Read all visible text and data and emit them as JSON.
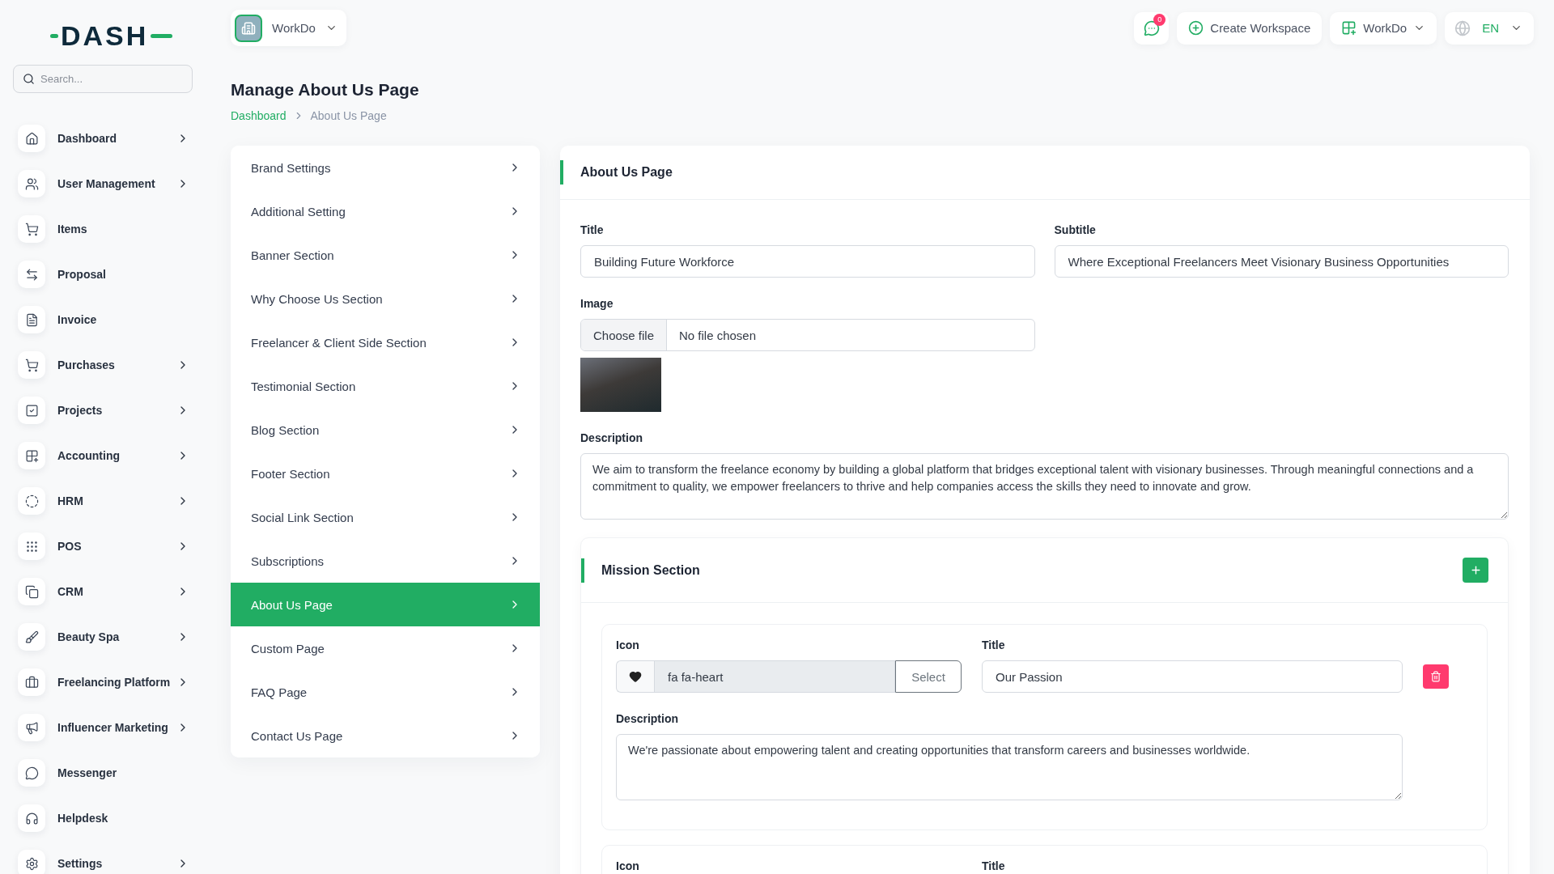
{
  "sidebar": {
    "logo": "DASH",
    "search": {
      "placeholder": "Search..."
    },
    "items": [
      {
        "label": "Dashboard",
        "submenu": true,
        "selected": false
      },
      {
        "label": "User Management",
        "submenu": true,
        "selected": false
      },
      {
        "label": "Items",
        "submenu": false,
        "selected": false
      },
      {
        "label": "Proposal",
        "submenu": false,
        "selected": false
      },
      {
        "label": "Invoice",
        "submenu": false,
        "selected": false
      },
      {
        "label": "Purchases",
        "submenu": true,
        "selected": false
      },
      {
        "label": "Projects",
        "submenu": true,
        "selected": false
      },
      {
        "label": "Accounting",
        "submenu": true,
        "selected": false
      },
      {
        "label": "HRM",
        "submenu": true,
        "selected": false
      },
      {
        "label": "POS",
        "submenu": true,
        "selected": false
      },
      {
        "label": "CRM",
        "submenu": true,
        "selected": false
      },
      {
        "label": "Beauty Spa",
        "submenu": true,
        "selected": false
      },
      {
        "label": "Freelancing Platform",
        "submenu": true,
        "selected": false
      },
      {
        "label": "Influencer Marketing",
        "submenu": true,
        "selected": false
      },
      {
        "label": "Messenger",
        "submenu": false,
        "selected": false
      },
      {
        "label": "Helpdesk",
        "submenu": false,
        "selected": false
      },
      {
        "label": "Settings",
        "submenu": true,
        "selected": false
      }
    ]
  },
  "topbar": {
    "workspace": "WorkDo",
    "messages_badge": "0",
    "create_workspace": "Create Workspace",
    "workspace_menu": "WorkDo",
    "language": "EN"
  },
  "header": {
    "title": "Manage About Us Page",
    "breadcrumb": [
      {
        "label": "Dashboard",
        "link": true
      },
      {
        "label": "About Us Page",
        "link": false
      }
    ]
  },
  "settings_menu": [
    {
      "label": "Brand Settings",
      "selected": false
    },
    {
      "label": "Additional Setting",
      "selected": false
    },
    {
      "label": "Banner Section",
      "selected": false
    },
    {
      "label": "Why Choose Us Section",
      "selected": false
    },
    {
      "label": "Freelancer & Client Side Section",
      "selected": false
    },
    {
      "label": "Testimonial Section",
      "selected": false
    },
    {
      "label": "Blog Section",
      "selected": false
    },
    {
      "label": "Footer Section",
      "selected": false
    },
    {
      "label": "Social Link Section",
      "selected": false
    },
    {
      "label": "Subscriptions",
      "selected": false
    },
    {
      "label": "About Us Page",
      "selected": true
    },
    {
      "label": "Custom Page",
      "selected": false
    },
    {
      "label": "FAQ Page",
      "selected": false
    },
    {
      "label": "Contact Us Page",
      "selected": false
    }
  ],
  "about_section": {
    "title": "About Us Page",
    "title_field": {
      "label": "Title",
      "value": "Building Future Workforce"
    },
    "subtitle_field": {
      "label": "Subtitle",
      "value": "Where Exceptional Freelancers Meet Visionary Business Opportunities"
    },
    "image_field": {
      "label": "Image",
      "button": "Choose file",
      "status": "No file chosen"
    },
    "description_field": {
      "label": "Description",
      "value": "We aim to transform the freelance economy by building a global platform that bridges exceptional talent with visionary businesses. Through meaningful connections and a commitment to quality, we empower freelancers to thrive and help companies access the skills they need to innovate and grow."
    }
  },
  "mission_section": {
    "title": "Mission Section",
    "items": [
      {
        "icon_field": {
          "label": "Icon",
          "value": "fa fa-heart",
          "readonly": true,
          "button": "Select"
        },
        "title_field": {
          "label": "Title",
          "value": "Our Passion"
        },
        "description_field": {
          "label": "Description",
          "value": "We're passionate about empowering talent and creating opportunities that transform careers and businesses worldwide."
        }
      },
      {
        "icon_field": {
          "label": "Icon"
        },
        "title_field": {
          "label": "Title"
        }
      }
    ]
  }
}
